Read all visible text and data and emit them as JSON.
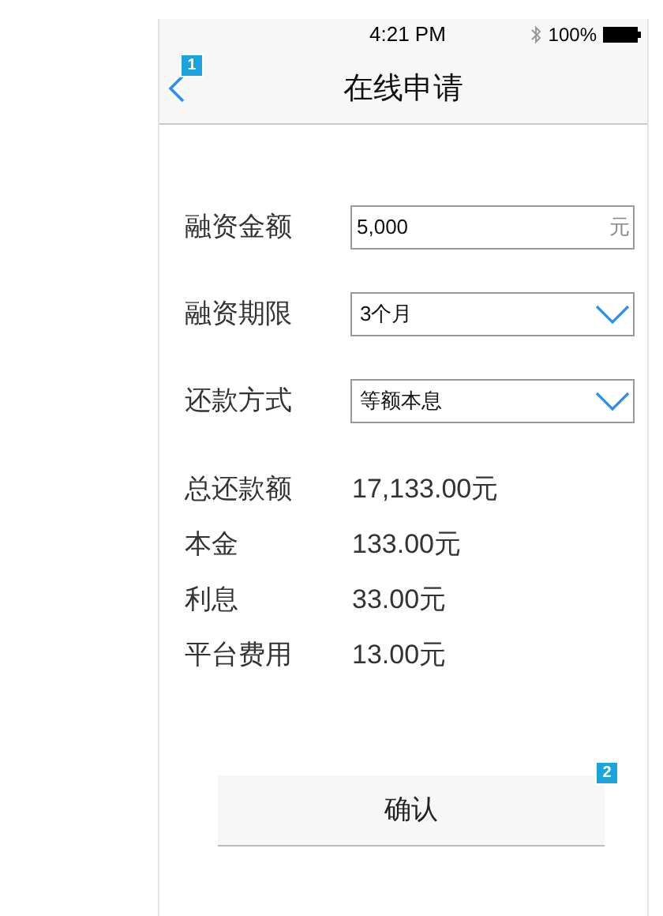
{
  "status_bar": {
    "time": "4:21 PM",
    "battery": "100%"
  },
  "nav": {
    "title": "在线申请",
    "badge": "1"
  },
  "form": [
    {
      "kind": "input",
      "label": "融资金额",
      "value": "5,000",
      "unit": "元"
    },
    {
      "kind": "select",
      "label": "融资期限",
      "value": "3个月"
    },
    {
      "kind": "select",
      "label": "还款方式",
      "value": "等额本息"
    }
  ],
  "summary": [
    {
      "label": "总还款额",
      "value": "17,133.00元"
    },
    {
      "label": "本金",
      "value": "133.00元"
    },
    {
      "label": "利息",
      "value": "33.00元"
    },
    {
      "label": "平台费用",
      "value": "13.00元"
    }
  ],
  "confirm": {
    "label": "确认",
    "badge": "2"
  }
}
